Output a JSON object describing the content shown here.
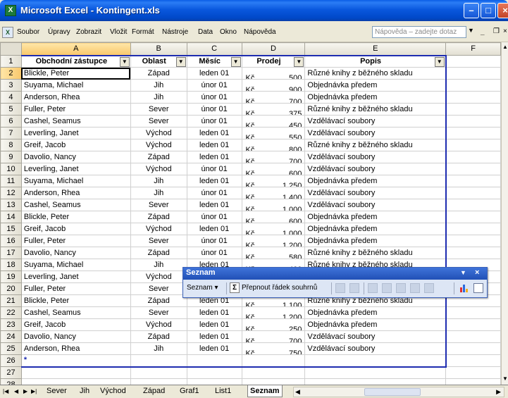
{
  "window": {
    "title": "Microsoft Excel - Kontingent.xls"
  },
  "menu": {
    "items": [
      "Soubor",
      "Úpravy",
      "Zobrazit",
      "Vložit",
      "Formát",
      "Nástroje",
      "Data",
      "Okno",
      "Nápověda"
    ],
    "help_placeholder": "Nápověda – zadejte dotaz"
  },
  "columns": [
    "A",
    "B",
    "C",
    "D",
    "E",
    "F"
  ],
  "headers": [
    "Obchodní zástupce",
    "Oblast",
    "Měsíc",
    "Prodej",
    "Popis"
  ],
  "rows": [
    [
      "Blickle, Peter",
      "Západ",
      "leden 01",
      "Kč",
      "500",
      "Různé knihy z běžného skladu"
    ],
    [
      "Suyama, Michael",
      "Jih",
      "únor 01",
      "Kč",
      "900",
      "Objednávka předem"
    ],
    [
      "Anderson, Rhea",
      "Jih",
      "únor 01",
      "Kč",
      "700",
      "Objednávka předem"
    ],
    [
      "Fuller, Peter",
      "Sever",
      "únor 01",
      "Kč",
      "375",
      "Různé knihy z běžného skladu"
    ],
    [
      "Cashel, Seamus",
      "Sever",
      "únor 01",
      "Kč",
      "450",
      "Vzdělávací soubory"
    ],
    [
      "Leverling, Janet",
      "Východ",
      "leden 01",
      "Kč",
      "550",
      "Vzdělávací soubory"
    ],
    [
      "Greif, Jacob",
      "Východ",
      "leden 01",
      "Kč",
      "800",
      "Různé knihy z běžného skladu"
    ],
    [
      "Davolio, Nancy",
      "Západ",
      "leden 01",
      "Kč",
      "700",
      "Vzdělávací soubory"
    ],
    [
      "Leverling, Janet",
      "Východ",
      "únor 01",
      "Kč",
      "600",
      "Vzdělávací soubory"
    ],
    [
      "Suyama, Michael",
      "Jih",
      "leden 01",
      "Kč",
      "1 250",
      "Objednávka předem"
    ],
    [
      "Anderson, Rhea",
      "Jih",
      "únor 01",
      "Kč",
      "1 400",
      "Vzdělávací soubory"
    ],
    [
      "Cashel, Seamus",
      "Sever",
      "leden 01",
      "Kč",
      "1 000",
      "Vzdělávací soubory"
    ],
    [
      "Blickle, Peter",
      "Západ",
      "únor 01",
      "Kč",
      "600",
      "Objednávka předem"
    ],
    [
      "Greif, Jacob",
      "Východ",
      "leden 01",
      "Kč",
      "1 000",
      "Objednávka předem"
    ],
    [
      "Fuller, Peter",
      "Sever",
      "únor 01",
      "Kč",
      "1 200",
      "Objednávka předem"
    ],
    [
      "Davolio, Nancy",
      "Západ",
      "únor 01",
      "Kč",
      "580",
      "Různé knihy z běžného skladu"
    ],
    [
      "Suyama, Michael",
      "Jih",
      "leden 01",
      "Kč",
      "400",
      "Různé knihy z běžného skladu"
    ],
    [
      "Leverling, Janet",
      "Východ",
      "leden 01",
      "Kč",
      "",
      ""
    ],
    [
      "Fuller, Peter",
      "Sever",
      "leden 01",
      "Kč",
      "",
      ""
    ],
    [
      "Blickle, Peter",
      "Západ",
      "leden 01",
      "Kč",
      "1 100",
      "Různé knihy z běžného skladu"
    ],
    [
      "Cashel, Seamus",
      "Sever",
      "leden 01",
      "Kč",
      "1 200",
      "Objednávka předem"
    ],
    [
      "Greif, Jacob",
      "Východ",
      "leden 01",
      "Kč",
      "250",
      "Objednávka předem"
    ],
    [
      "Davolio, Nancy",
      "Západ",
      "leden 01",
      "Kč",
      "700",
      "Vzdělávací soubory"
    ],
    [
      "Anderson, Rhea",
      "Jih",
      "leden 01",
      "Kč",
      "750",
      "Vzdělávací soubory"
    ]
  ],
  "row_numbers": [
    "1",
    "2",
    "3",
    "4",
    "5",
    "6",
    "7",
    "8",
    "9",
    "10",
    "11",
    "12",
    "13",
    "14",
    "15",
    "16",
    "17",
    "18",
    "19",
    "20",
    "21",
    "22",
    "23",
    "24",
    "25",
    "26",
    "27",
    "28"
  ],
  "new_row_marker": "*",
  "sheet_tabs": [
    "Sever",
    "Jih",
    "Východ",
    "Západ",
    "Graf1",
    "List1",
    "Seznam"
  ],
  "active_tab": "Seznam",
  "floating_toolbar": {
    "title": "Seznam",
    "menu_label": "Seznam ▾",
    "sigma": "Σ",
    "toggle_label": "Přepnout řádek souhrnů"
  },
  "colors": {
    "title_bar": "#0a58de",
    "list_border": "#1e2cb0",
    "toolbar_title": "#2150b6"
  }
}
